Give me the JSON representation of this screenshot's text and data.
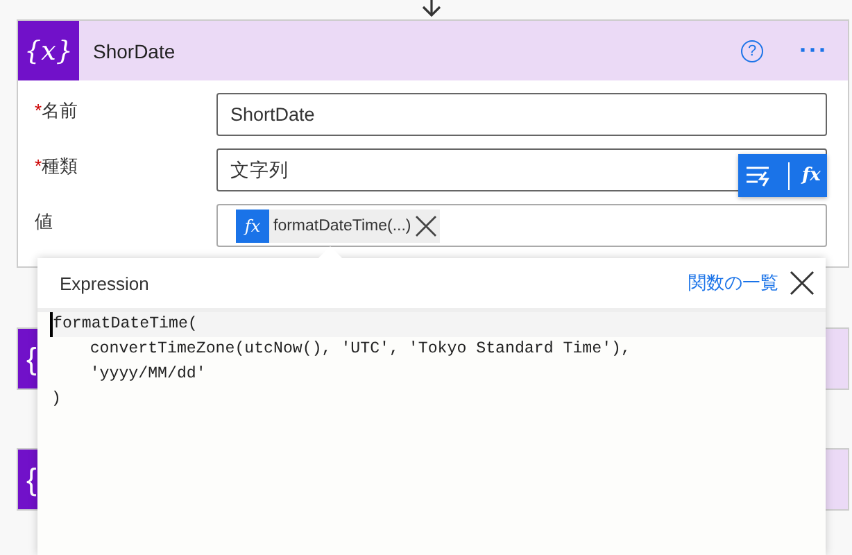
{
  "card": {
    "icon_text": "{x}",
    "title": "ShorDate",
    "help_icon": "?",
    "more": "···",
    "required_mark": "*",
    "fields": [
      {
        "label": "名前",
        "required": true,
        "kind": "text",
        "value": "ShortDate"
      },
      {
        "label": "種類",
        "required": true,
        "kind": "text",
        "value": "文字列"
      },
      {
        "label": "値",
        "required": false,
        "kind": "token",
        "token": "formatDateTime(...)",
        "token_icon": "fx"
      }
    ],
    "floating_fx": "fx"
  },
  "background_cards": [
    {
      "icon_text": "{"
    },
    {
      "icon_text": "{"
    }
  ],
  "expression_popup": {
    "title": "Expression",
    "link": "関数の一覧",
    "code_lines": [
      "formatDateTime(",
      "    convertTimeZone(utcNow(), 'UTC', 'Tokyo Standard Time'),",
      "    'yyyy/MM/dd'",
      ")"
    ]
  }
}
